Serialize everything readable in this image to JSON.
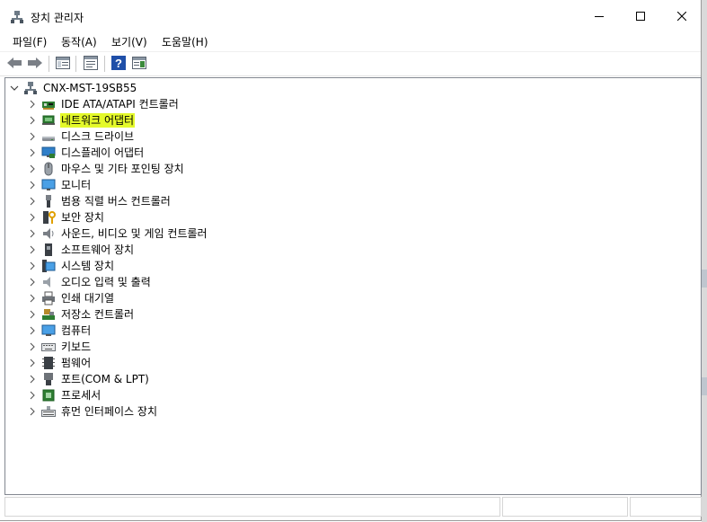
{
  "window": {
    "title": "장치 관리자",
    "minimize_icon": "minimize-icon",
    "maximize_icon": "maximize-icon",
    "close_icon": "close-icon"
  },
  "menu": {
    "items": [
      {
        "label": "파일(F)"
      },
      {
        "label": "동작(A)"
      },
      {
        "label": "보기(V)"
      },
      {
        "label": "도움말(H)"
      }
    ]
  },
  "toolbar": {
    "buttons": [
      "back-arrow-icon",
      "forward-arrow-icon",
      "show-hide-console-tree-icon",
      "properties-icon",
      "help-icon",
      "action-pane-icon"
    ]
  },
  "tree": {
    "root": {
      "label": "CNX-MST-19SB55",
      "icon": "computer-icon",
      "expanded": true
    },
    "items": [
      {
        "label": "IDE ATA/ATAPI 컨트롤러",
        "icon": "ide-controller-icon"
      },
      {
        "label": "네트워크 어댑터",
        "icon": "network-adapter-icon",
        "selected": true
      },
      {
        "label": "디스크 드라이브",
        "icon": "disk-drive-icon"
      },
      {
        "label": "디스플레이 어댑터",
        "icon": "display-adapter-icon"
      },
      {
        "label": "마우스 및 기타 포인팅 장치",
        "icon": "mouse-icon"
      },
      {
        "label": "모니터",
        "icon": "monitor-icon"
      },
      {
        "label": "범용 직렬 버스 컨트롤러",
        "icon": "usb-icon"
      },
      {
        "label": "보안 장치",
        "icon": "security-device-icon"
      },
      {
        "label": "사운드, 비디오 및 게임 컨트롤러",
        "icon": "sound-icon"
      },
      {
        "label": "소프트웨어 장치",
        "icon": "software-device-icon"
      },
      {
        "label": "시스템 장치",
        "icon": "system-device-icon"
      },
      {
        "label": "오디오 입력 및 출력",
        "icon": "audio-io-icon"
      },
      {
        "label": "인쇄 대기열",
        "icon": "print-queue-icon"
      },
      {
        "label": "저장소 컨트롤러",
        "icon": "storage-controller-icon"
      },
      {
        "label": "컴퓨터",
        "icon": "computer-monitor-icon"
      },
      {
        "label": "키보드",
        "icon": "keyboard-icon"
      },
      {
        "label": "펌웨어",
        "icon": "firmware-icon"
      },
      {
        "label": "포트(COM & LPT)",
        "icon": "port-icon"
      },
      {
        "label": "프로세서",
        "icon": "processor-icon"
      },
      {
        "label": "휴먼 인터페이스 장치",
        "icon": "hid-icon"
      }
    ]
  },
  "colors": {
    "selection_highlight": "#e4f92a",
    "border": "#828790",
    "accent_blue": "#1e6fc0"
  }
}
